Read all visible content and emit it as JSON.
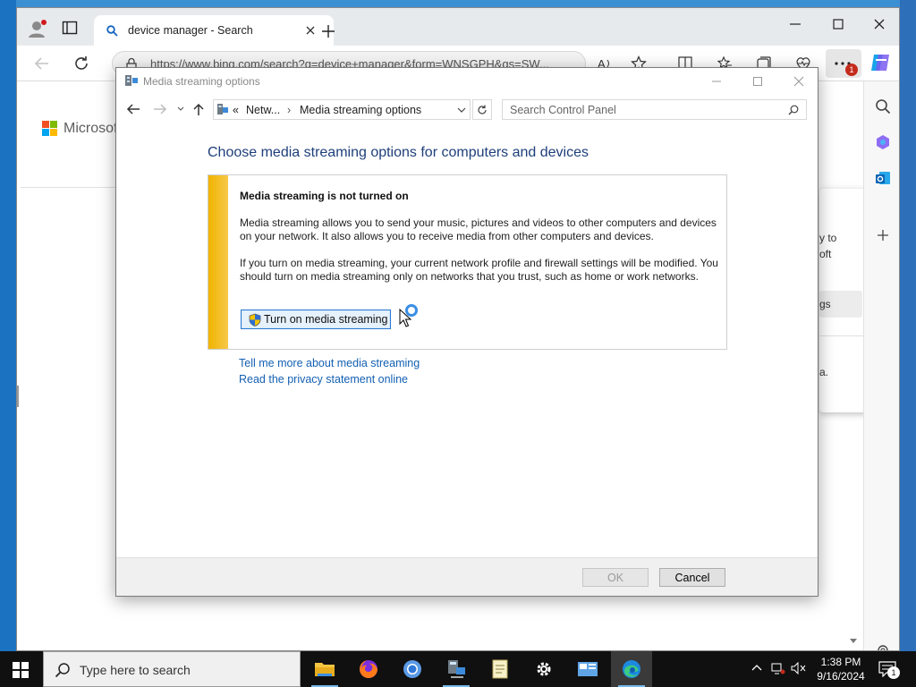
{
  "browser": {
    "tab_title": "device manager - Search",
    "url": "https://www.bing.com/search?q=device+manager&form=WNSGPH&qs=SW...",
    "notification_count": "1",
    "page_brand": "Microsoft",
    "flyout_text_1": "y to",
    "flyout_text_2": "oft",
    "flyout_button_fragment": "gs",
    "flyout_text_3": "a."
  },
  "dialog": {
    "title": "Media streaming options",
    "breadcrumb_root": "Netw...",
    "breadcrumb_current": "Media streaming options",
    "search_placeholder": "Search Control Panel",
    "heading": "Choose media streaming options for computers and devices",
    "info_title": "Media streaming is not turned on",
    "info_para1": "Media streaming allows you to send your music, pictures and videos to other computers and devices on your network.  It also allows you to receive media from other computers and devices.",
    "info_para2": "If you turn on media streaming, your current network profile and firewall settings will be modified. You should turn on media streaming only on networks that you trust, such as home or work networks.",
    "turn_on_button": "Turn on media streaming",
    "link_learn_more": "Tell me more about media streaming",
    "link_privacy": "Read the privacy statement online",
    "ok_button": "OK",
    "cancel_button": "Cancel"
  },
  "taskbar": {
    "search_placeholder": "Type here to search",
    "time": "1:38 PM",
    "date": "9/16/2024",
    "notification_count": "1"
  }
}
